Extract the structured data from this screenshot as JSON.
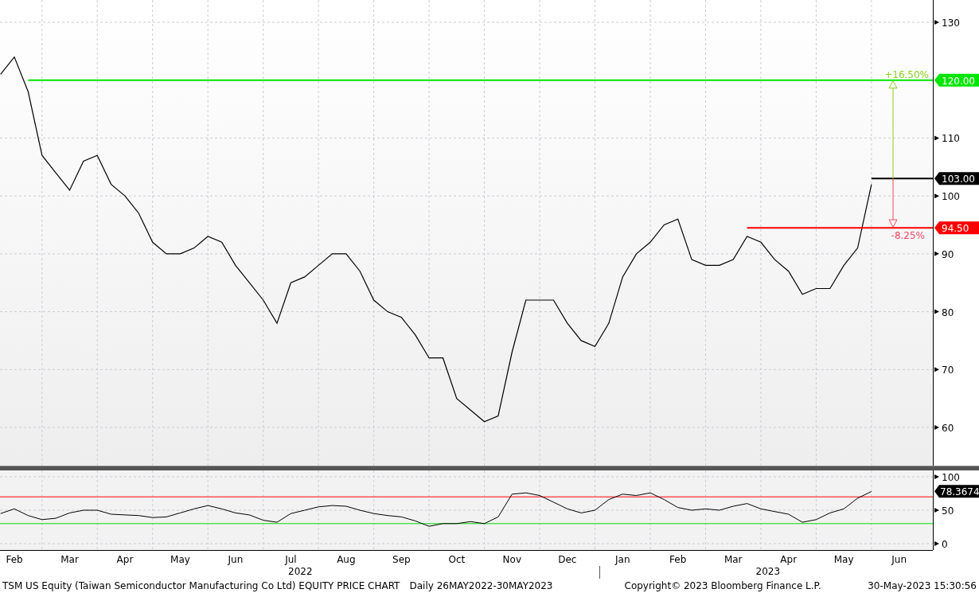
{
  "price_panel": {
    "chart_data": {
      "type": "line",
      "grid": true,
      "series": [
        {
          "color": "#000000",
          "values": [
            121,
            124,
            118,
            107,
            104,
            101,
            106,
            107,
            102,
            100,
            97,
            92,
            90,
            90,
            91,
            93,
            92,
            88,
            85,
            82,
            78,
            85,
            86,
            88,
            90,
            90,
            87,
            82,
            80,
            79,
            76,
            72,
            72,
            65,
            63,
            61,
            62,
            73,
            82,
            82,
            82,
            78,
            75,
            74,
            78,
            86,
            90,
            92,
            95,
            96,
            89,
            88,
            88,
            89,
            93,
            92,
            89,
            87,
            83,
            84,
            84,
            88,
            91,
            102,
            null,
            null
          ]
        }
      ],
      "ylim": [
        53.4,
        133.85
      ],
      "yticks": [
        60,
        70,
        80,
        90,
        100,
        110,
        130
      ],
      "ref_lines": [
        {
          "axis": "y",
          "value": 120,
          "label": "120.00",
          "color": "#00e600"
        },
        {
          "axis": "y",
          "value": 103,
          "label": "103.00",
          "color": "#000000"
        },
        {
          "axis": "y",
          "value": 94.5,
          "label": "94.50",
          "color": "#ff0000"
        }
      ],
      "annotations": [
        "+16.50%",
        "-8.25%"
      ]
    }
  },
  "rsi_panel": {
    "chart_data": {
      "type": "line",
      "grid": true,
      "categories": [
        null,
        "Feb",
        null,
        null,
        null,
        "Mar",
        null,
        null,
        null,
        "Apr",
        null,
        null,
        null,
        "May",
        null,
        null,
        null,
        "Jun",
        null,
        null,
        null,
        "Jul",
        null,
        null,
        null,
        "Aug",
        null,
        null,
        null,
        "Sep",
        null,
        null,
        null,
        "Oct",
        null,
        null,
        null,
        "Nov",
        null,
        null,
        null,
        "Dec",
        null,
        null,
        null,
        "Jan",
        null,
        null,
        null,
        "Feb",
        null,
        null,
        null,
        "Mar",
        null,
        null,
        null,
        "Apr",
        null,
        null,
        null,
        "May",
        null,
        null,
        null,
        "Jun"
      ],
      "series": [
        {
          "color": "#000000",
          "values": [
            45,
            52,
            42,
            36,
            38,
            46,
            50,
            50,
            44,
            43,
            42,
            39,
            40,
            46,
            52,
            57,
            52,
            46,
            43,
            35,
            32,
            45,
            50,
            55,
            57,
            56,
            50,
            45,
            42,
            40,
            34,
            26,
            30,
            30,
            33,
            30,
            40,
            74,
            76,
            72,
            62,
            52,
            46,
            50,
            66,
            74,
            72,
            76,
            66,
            54,
            50,
            52,
            50,
            56,
            60,
            52,
            48,
            44,
            32,
            36,
            46,
            52,
            68,
            78,
            null,
            null
          ]
        }
      ],
      "ylim": [
        -9.5,
        109.5
      ],
      "yticks": [
        0,
        50,
        100
      ],
      "ref_lines": [
        {
          "axis": "y",
          "value": 70,
          "color": "#ff0000"
        },
        {
          "axis": "y",
          "value": 30,
          "color": "#00dd00"
        }
      ],
      "annotations": [
        "78.3674"
      ]
    }
  },
  "years": [
    "2022",
    "2023"
  ],
  "footer": {
    "description": "TSM US Equity (Taiwan Semiconductor Manufacturing Co Ltd) EQUITY PRICE CHART",
    "range": "Daily 26MAY2022-30MAY2023",
    "copyright": "Copyright© 2023 Bloomberg Finance L.P.",
    "timestamp": "30-May-2023 15:30:56"
  }
}
